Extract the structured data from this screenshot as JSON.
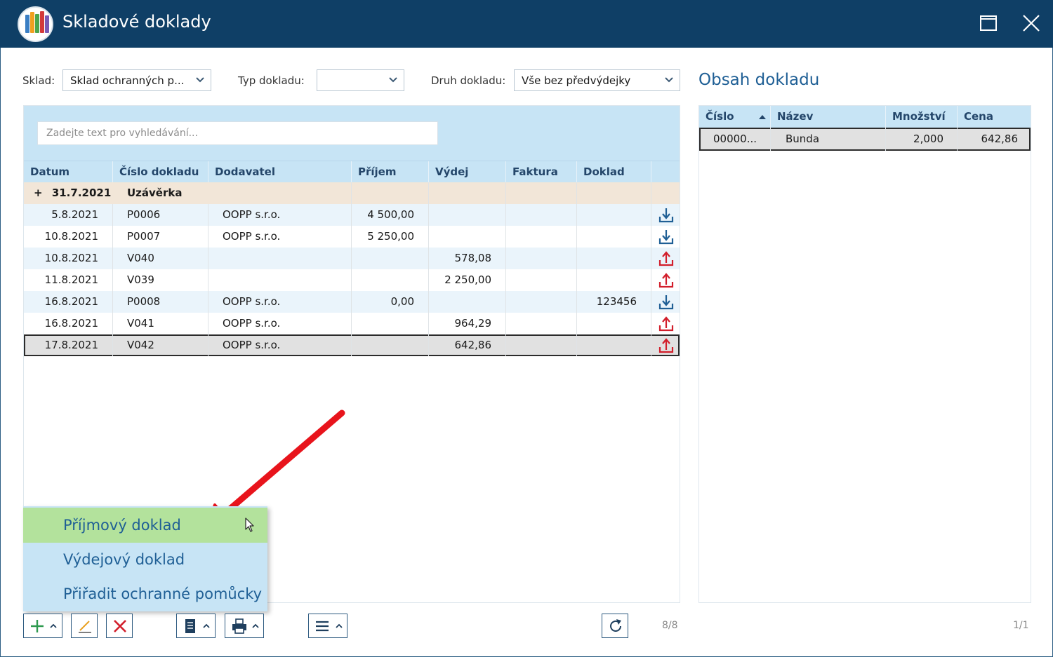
{
  "window": {
    "title": "Skladové doklady"
  },
  "filters": {
    "sklad_label": "Sklad:",
    "sklad_value": "Sklad ochranných p...",
    "typ_label": "Typ dokladu:",
    "typ_value": "",
    "druh_label": "Druh dokladu:",
    "druh_value": "Vše bez předvýdejky"
  },
  "search": {
    "placeholder": "Zadejte text pro vyhledávání..."
  },
  "grid": {
    "columns": [
      "Datum",
      "Číslo dokladu",
      "Dodavatel",
      "Příjem",
      "Výdej",
      "Faktura",
      "Doklad"
    ],
    "group": {
      "toggle": "+",
      "date": "31.7.2021",
      "label": "Uzávěrka"
    },
    "rows": [
      {
        "datum": "5.8.2021",
        "cislo": "P0006",
        "dodavatel": "OOPP s.r.o.",
        "prijem": "4 500,00",
        "vydej": "",
        "faktura": "",
        "doklad": "",
        "icon": "download-icon"
      },
      {
        "datum": "10.8.2021",
        "cislo": "P0007",
        "dodavatel": "OOPP s.r.o.",
        "prijem": "5 250,00",
        "vydej": "",
        "faktura": "",
        "doklad": "",
        "icon": "download-icon"
      },
      {
        "datum": "10.8.2021",
        "cislo": "V040",
        "dodavatel": "",
        "prijem": "",
        "vydej": "578,08",
        "faktura": "",
        "doklad": "",
        "icon": "upload-icon"
      },
      {
        "datum": "11.8.2021",
        "cislo": "V039",
        "dodavatel": "",
        "prijem": "",
        "vydej": "2 250,00",
        "faktura": "",
        "doklad": "",
        "icon": "upload-icon"
      },
      {
        "datum": "16.8.2021",
        "cislo": "P0008",
        "dodavatel": "OOPP s.r.o.",
        "prijem": "0,00",
        "vydej": "",
        "faktura": "",
        "doklad": "123456",
        "icon": "download-icon"
      },
      {
        "datum": "16.8.2021",
        "cislo": "V041",
        "dodavatel": "OOPP s.r.o.",
        "prijem": "",
        "vydej": "964,29",
        "faktura": "",
        "doklad": "",
        "icon": "upload-icon"
      },
      {
        "datum": "17.8.2021",
        "cislo": "V042",
        "dodavatel": "OOPP s.r.o.",
        "prijem": "",
        "vydej": "642,86",
        "faktura": "",
        "doklad": "",
        "icon": "upload-icon"
      }
    ],
    "count": "8/8"
  },
  "detail": {
    "title": "Obsah dokladu",
    "columns": [
      "Číslo",
      "Název",
      "Množství",
      "Cena"
    ],
    "rows": [
      {
        "cislo": "00000...",
        "nazev": "Bunda",
        "mnozstvi": "2,000",
        "cena": "642,86"
      }
    ],
    "count": "1/1"
  },
  "add_menu": {
    "items": [
      "Příjmový doklad",
      "Výdejový doklad",
      "Přiřadit ochranné pomůcky"
    ]
  },
  "colors": {
    "title_bar": "#0f3f66",
    "header_blue": "#c7e4f5",
    "group_row": "#f2e6d8",
    "menu_active": "#b3e29c",
    "download": "#1f5f95",
    "upload": "#d21e2b",
    "annotation_arrow": "#e8141c"
  }
}
